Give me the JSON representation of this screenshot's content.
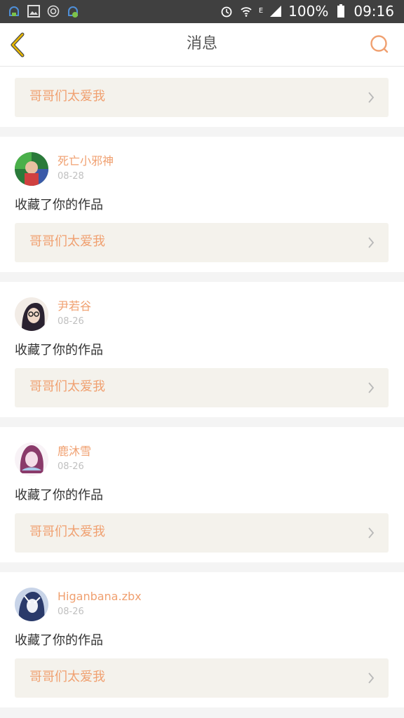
{
  "status_bar": {
    "network_type": "E",
    "battery": "100%",
    "time": "09:16",
    "left_icons": [
      "notification-icon",
      "image-icon",
      "target-icon",
      "download-icon"
    ],
    "right_icons": [
      "alarm-icon",
      "wifi-icon",
      "signal-icon",
      "battery-icon"
    ]
  },
  "nav": {
    "title": "消息",
    "back_icon": "chevron-left-icon",
    "search_icon": "search-icon"
  },
  "colors": {
    "accent": "#f0a070",
    "back_arrow": "#e8b800",
    "link_bg": "#f4f2ec",
    "separator": "#f4f4f4"
  },
  "top_card": {
    "work_title": "哥哥们太爱我"
  },
  "notifications": [
    {
      "username": "死亡小邪神",
      "date": "08-28",
      "action": "收藏了你的作品",
      "work_title": "哥哥们太爱我"
    },
    {
      "username": "尹若谷",
      "date": "08-26",
      "action": "收藏了你的作品",
      "work_title": "哥哥们太爱我"
    },
    {
      "username": "鹿沐雪",
      "date": "08-26",
      "action": "收藏了你的作品",
      "work_title": "哥哥们太爱我"
    },
    {
      "username": "Higanbana.zbx",
      "date": "08-26",
      "action": "收藏了你的作品",
      "work_title": "哥哥们太爱我"
    }
  ]
}
